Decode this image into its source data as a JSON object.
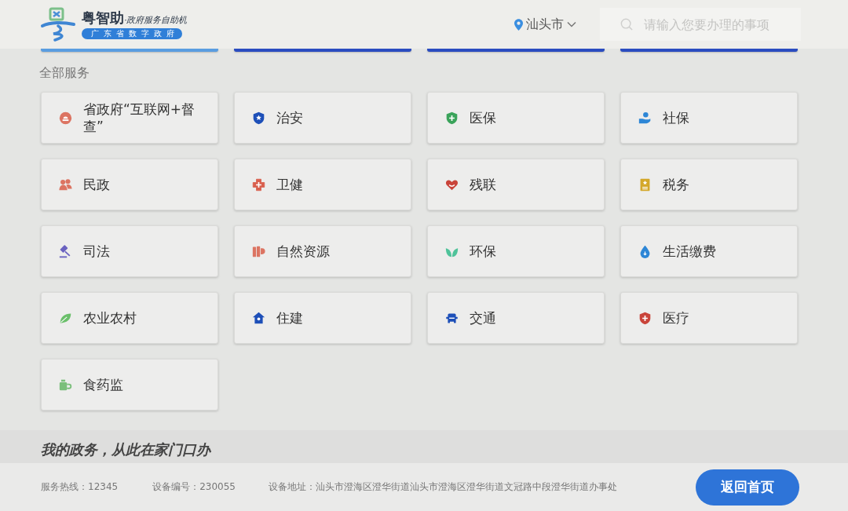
{
  "header": {
    "app_name": "粤智助",
    "subtitle": "·政府服务自助机",
    "badge": "广东省数字政府",
    "city": "汕头市",
    "search": {
      "placeholder": "请输入您要办理的事项"
    }
  },
  "cut_off_cards": [
    {
      "color": "#5a9de0"
    },
    {
      "color": "#2a4cc0"
    },
    {
      "color": "#2a4cc0"
    },
    {
      "color": "#2a4cc0"
    }
  ],
  "section_title": "全部服务",
  "services": [
    {
      "label": "省政府“互联网+督查”",
      "color": "#dc7462"
    },
    {
      "label": "治安",
      "color": "#1d4fb8"
    },
    {
      "label": "医保",
      "color": "#3aa35a"
    },
    {
      "label": "社保",
      "color": "#2d86d6"
    },
    {
      "label": "民政",
      "color": "#dc7462"
    },
    {
      "label": "卫健",
      "color": "#d9604e"
    },
    {
      "label": "残联",
      "color": "#c9443a"
    },
    {
      "label": "税务",
      "color": "#d4a82a"
    },
    {
      "label": "司法",
      "color": "#6a62c0"
    },
    {
      "label": "自然资源",
      "color": "#dc7462"
    },
    {
      "label": "环保",
      "color": "#4fc39a"
    },
    {
      "label": "生活缴费",
      "color": "#2d86d6"
    },
    {
      "label": "农业农村",
      "color": "#6abf6a"
    },
    {
      "label": "住建",
      "color": "#1d4fb8"
    },
    {
      "label": "交通",
      "color": "#1d4fb8"
    },
    {
      "label": "医疗",
      "color": "#c9443a"
    },
    {
      "label": "食药监",
      "color": "#7bbf7b"
    }
  ],
  "slogan": "我的政务，从此在家门口办",
  "footer": {
    "hotline": "服务热线：12345",
    "device_number": "设备编号：230055",
    "device_address": "设备地址：汕头市澄海区澄华街道汕头市澄海区澄华街道文冠路中段澄华街道办事处",
    "home_button": "返回首页"
  }
}
